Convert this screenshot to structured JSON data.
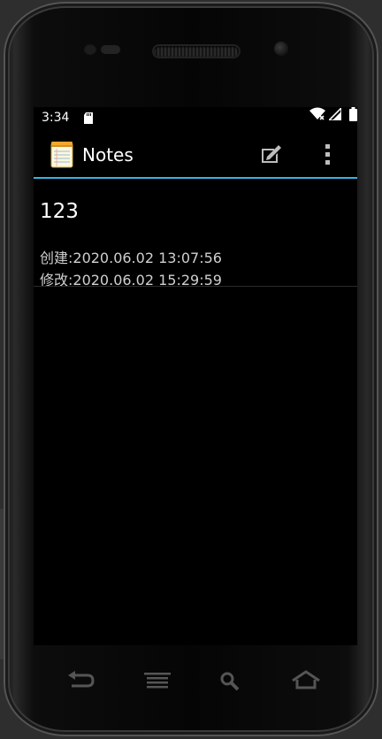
{
  "status_bar": {
    "time": "3:34",
    "icons": [
      "sd-card-icon",
      "wifi-icon",
      "signal-icon",
      "battery-icon"
    ]
  },
  "action_bar": {
    "title": "Notes",
    "accent_color": "#33b5e5",
    "icons": [
      "notepad-app-icon",
      "compose-icon",
      "overflow-menu-icon"
    ]
  },
  "notes": [
    {
      "title": "123",
      "created": "创建:2020.06.02 13:07:56",
      "modified": "修改:2020.06.02 15:29:59"
    }
  ],
  "hardware_keys": [
    "back-icon",
    "menu-icon",
    "search-icon",
    "home-icon"
  ]
}
